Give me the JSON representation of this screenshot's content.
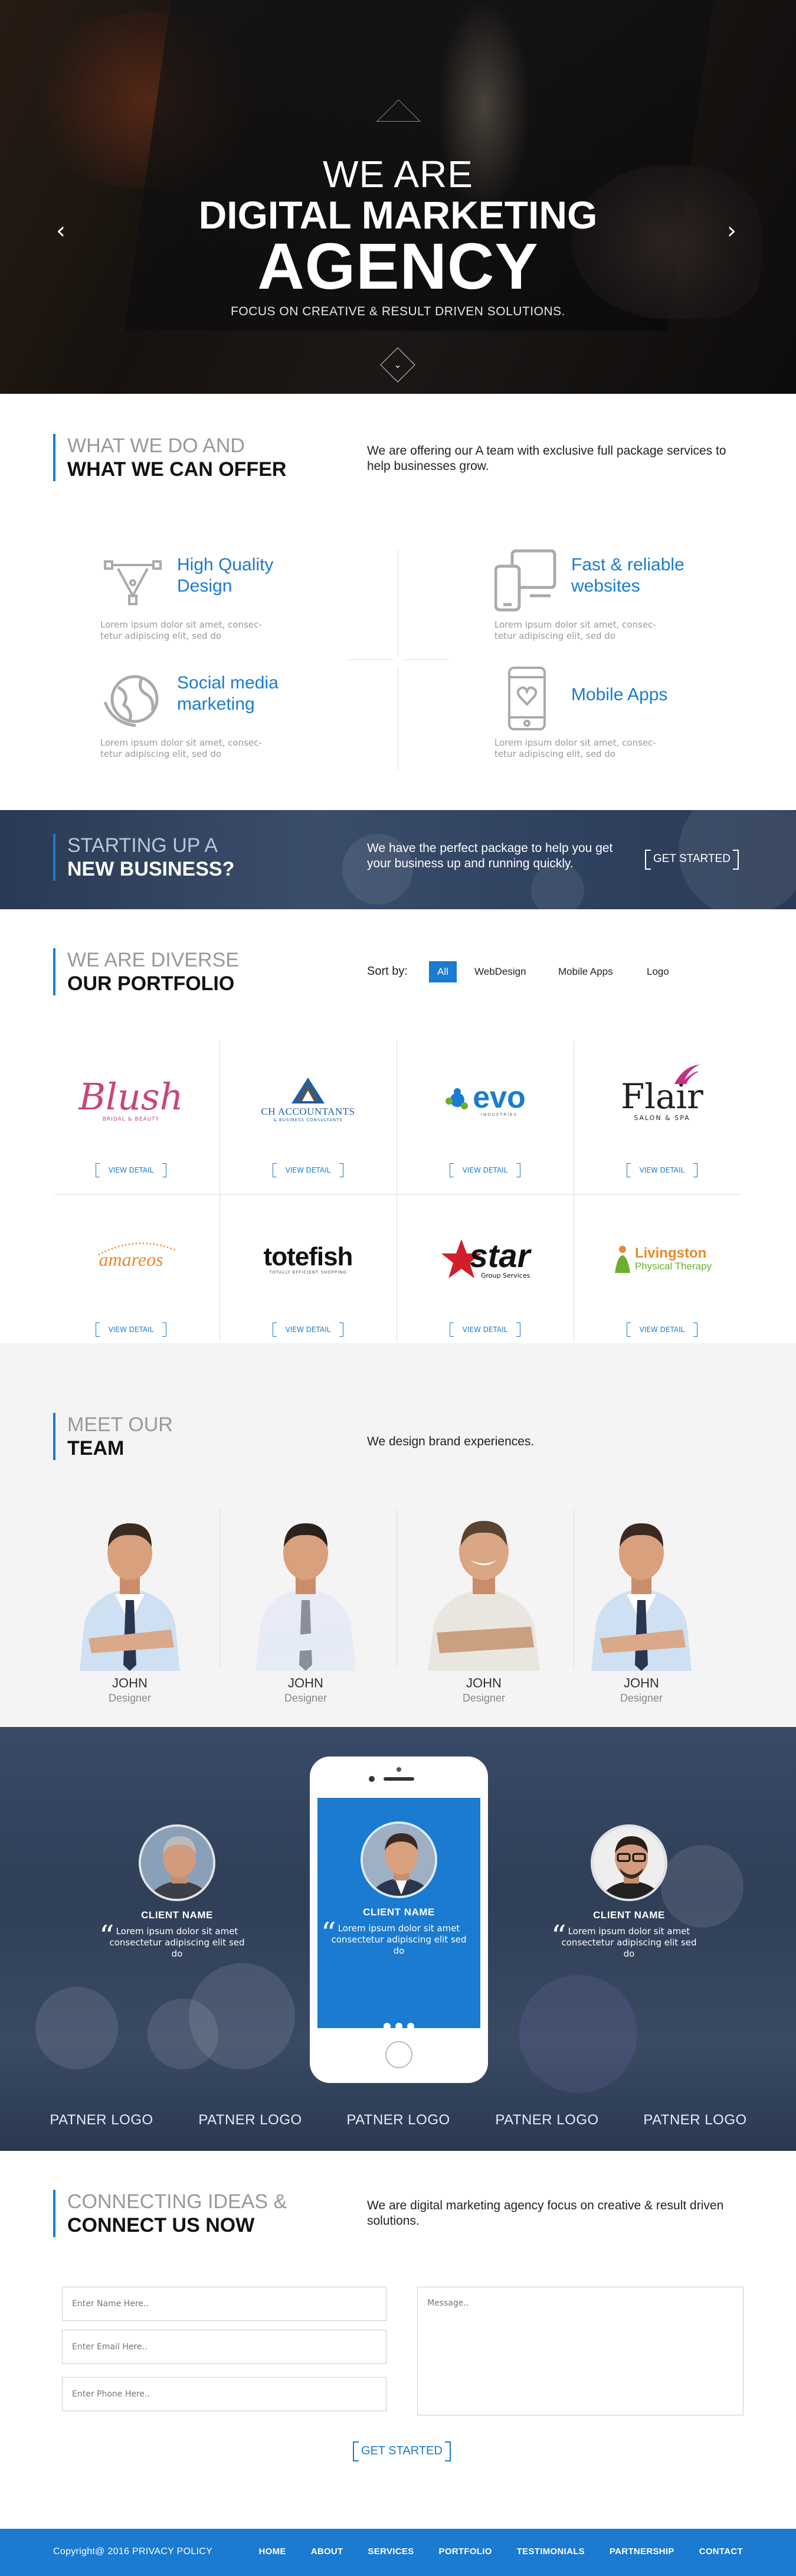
{
  "colors": {
    "accent": "#1a7bd0",
    "dark_band": "#34455f"
  },
  "hero": {
    "line1": "WE ARE",
    "line2": "DIGITAL MARKETING",
    "line3": "AGENCY",
    "sub": "FOCUS ON CREATIVE & RESULT DRIVEN SOLUTIONS.",
    "prev_icon": "chevron-left-icon",
    "next_icon": "chevron-right-icon",
    "down_icon": "chevron-down-icon",
    "prev_glyph": "‹",
    "next_glyph": "›",
    "down_glyph": "⌄"
  },
  "services": {
    "head1": "WHAT WE DO AND",
    "head2": "WHAT WE CAN OFFER",
    "desc": "We are offering our A team with exclusive full package services to help businesses grow.",
    "items": [
      {
        "name_l1": "High Quality",
        "name_l2": "Design",
        "text": "Lorem ipsum dolor sit amet, consec-tetur adipiscing elit, sed do",
        "icon": "vector-pen-icon"
      },
      {
        "name_l1": "Fast & reliable",
        "name_l2": "websites",
        "text": "Lorem ipsum dolor sit amet, consec-tetur adipiscing elit, sed do",
        "icon": "devices-icon"
      },
      {
        "name_l1": "Social media",
        "name_l2": "marketing",
        "text": "Lorem ipsum dolor sit amet, consec-tetur adipiscing elit, sed do",
        "icon": "globe-icon"
      },
      {
        "name_l1": "Mobile Apps",
        "name_l2": "",
        "text": "Lorem ipsum dolor sit amet, consec-tetur adipiscing elit, sed do",
        "icon": "mobile-heart-icon"
      }
    ]
  },
  "startup": {
    "head1": "STARTING UP A",
    "head2": "NEW BUSINESS?",
    "desc": "We have the perfect package to help you get your business up and running quickly.",
    "button": "GET STARTED"
  },
  "portfolio": {
    "head1": "WE ARE DIVERSE",
    "head2": "OUR PORTFOLIO",
    "sort_label": "Sort by:",
    "sort_options": [
      "All",
      "WebDesign",
      "Mobile Apps",
      "Logo"
    ],
    "view_label": "VIEW DETAIL",
    "logos": [
      {
        "name": "Blush",
        "sub": "BRIDAL & BEAUTY"
      },
      {
        "name": "CH ACCOUNTANTS",
        "sub": "& BUSINESS CONSULTANTS"
      },
      {
        "name": "evo",
        "sub": "INDUSTRIES"
      },
      {
        "name": "Flair",
        "sub": "SALON & SPA"
      },
      {
        "name": "amareos",
        "sub": ""
      },
      {
        "name": "totefish",
        "sub": "TOTALLY EFFICIENT SHOPPING"
      },
      {
        "name": "star",
        "sub": "Group Services"
      },
      {
        "name": "Livingston",
        "sub": "Physical Therapy"
      }
    ]
  },
  "team": {
    "head1": "MEET OUR",
    "head2": "TEAM",
    "desc": "We design brand experiences.",
    "members": [
      {
        "name": "JOHN",
        "role": "Designer"
      },
      {
        "name": "JOHN",
        "role": "Designer"
      },
      {
        "name": "JOHN",
        "role": "Designer"
      },
      {
        "name": "JOHN",
        "role": "Designer"
      }
    ]
  },
  "testimonials": {
    "clients": [
      {
        "name": "CLIENT NAME",
        "quote": "Lorem ipsum dolor sit amet consectetur adipiscing elit sed do"
      },
      {
        "name": "CLIENT NAME",
        "quote": "Lorem ipsum dolor sit amet consectetur adipiscing elit sed do"
      },
      {
        "name": "CLIENT NAME",
        "quote": "Lorem ipsum dolor sit amet consectetur adipiscing elit sed do"
      }
    ],
    "quote_mark": "“",
    "partners": [
      "PATNER LOGO",
      "PATNER LOGO",
      "PATNER LOGO",
      "PATNER LOGO",
      "PATNER LOGO"
    ]
  },
  "contact": {
    "head1": "CONNECTING IDEAS &",
    "head2": "CONNECT US NOW",
    "desc": "We are digital marketing agency focus on creative & result driven solutions.",
    "name_placeholder": "Enter Name Here..",
    "email_placeholder": "Enter Email Here..",
    "phone_placeholder": "Enter Phone Here..",
    "message_placeholder": "Message..",
    "button": "GET STARTED"
  },
  "footer": {
    "copyright": "Copyright@ 2016 PRIVACY POLICY",
    "nav": [
      "HOME",
      "ABOUT",
      "SERVICES",
      "PORTFOLIO",
      "TESTIMONIALS",
      "PARTNERSHIP",
      "CONTACT"
    ]
  }
}
